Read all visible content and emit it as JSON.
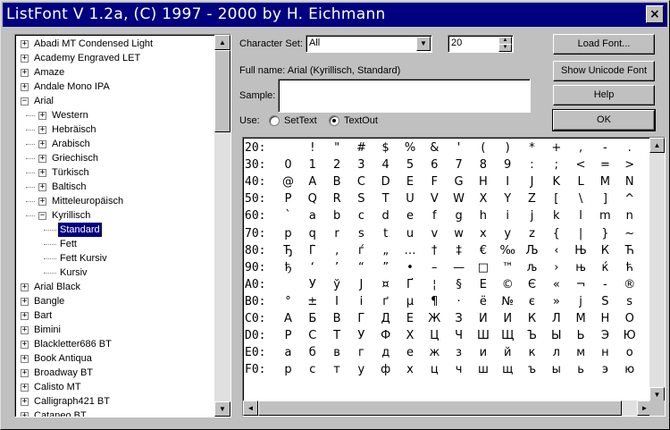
{
  "window": {
    "title": "ListFont V 1.2a, (C) 1997 - 2000 by H. Eichmann",
    "close_label": "×"
  },
  "tree": [
    {
      "label": "Abadi MT Condensed Light",
      "level": 0,
      "expander": "+"
    },
    {
      "label": "Academy Engraved LET",
      "level": 0,
      "expander": "+"
    },
    {
      "label": "Amaze",
      "level": 0,
      "expander": "+"
    },
    {
      "label": "Andale Mono IPA",
      "level": 0,
      "expander": "+"
    },
    {
      "label": "Arial",
      "level": 0,
      "expander": "−"
    },
    {
      "label": "Western",
      "level": 1,
      "expander": "+"
    },
    {
      "label": "Hebräisch",
      "level": 1,
      "expander": "+"
    },
    {
      "label": "Arabisch",
      "level": 1,
      "expander": "+"
    },
    {
      "label": "Griechisch",
      "level": 1,
      "expander": "+"
    },
    {
      "label": "Türkisch",
      "level": 1,
      "expander": "+"
    },
    {
      "label": "Baltisch",
      "level": 1,
      "expander": "+"
    },
    {
      "label": "Mitteleuropäisch",
      "level": 1,
      "expander": "+"
    },
    {
      "label": "Kyrillisch",
      "level": 1,
      "expander": "−"
    },
    {
      "label": "Standard",
      "level": 2,
      "expander": "",
      "selected": true
    },
    {
      "label": "Fett",
      "level": 2,
      "expander": ""
    },
    {
      "label": "Fett Kursiv",
      "level": 2,
      "expander": ""
    },
    {
      "label": "Kursiv",
      "level": 2,
      "expander": ""
    },
    {
      "label": "Arial Black",
      "level": 0,
      "expander": "+"
    },
    {
      "label": "Bangle",
      "level": 0,
      "expander": "+"
    },
    {
      "label": "Bart",
      "level": 0,
      "expander": "+"
    },
    {
      "label": "Bimini",
      "level": 0,
      "expander": "+"
    },
    {
      "label": "Blackletter686 BT",
      "level": 0,
      "expander": "+"
    },
    {
      "label": "Book Antiqua",
      "level": 0,
      "expander": "+"
    },
    {
      "label": "Broadway BT",
      "level": 0,
      "expander": "+"
    },
    {
      "label": "Calisto MT",
      "level": 0,
      "expander": "+"
    },
    {
      "label": "Calligraph421 BT",
      "level": 0,
      "expander": "+"
    },
    {
      "label": "Cataneo BT",
      "level": 0,
      "expander": "+"
    }
  ],
  "controls": {
    "charset_label": "Character Set:",
    "charset_value": "All",
    "size_value": "20",
    "fullname": "Full name: Arial (Kyrillisch, Standard)",
    "sample_label": "Sample:",
    "sample_value": "",
    "use_label": "Use:",
    "radio_settext": "SetText",
    "radio_textout": "TextOut",
    "radio_selected": "TextOut"
  },
  "buttons": {
    "load_font": "Load Font...",
    "show_unicode": "Show Unicode Font",
    "help": "Help",
    "ok": "OK"
  },
  "charmap": [
    {
      "label": "20:",
      "chars": [
        "",
        "!",
        "\"",
        "#",
        "$",
        "%",
        "&",
        "'",
        "(",
        ")",
        "*",
        "+",
        ",",
        "-",
        ".",
        "/"
      ]
    },
    {
      "label": "30:",
      "chars": [
        "0",
        "1",
        "2",
        "3",
        "4",
        "5",
        "6",
        "7",
        "8",
        "9",
        ":",
        ";",
        "<",
        "=",
        ">",
        "?"
      ]
    },
    {
      "label": "40:",
      "chars": [
        "@",
        "A",
        "B",
        "C",
        "D",
        "E",
        "F",
        "G",
        "H",
        "I",
        "J",
        "K",
        "L",
        "M",
        "N",
        "O"
      ]
    },
    {
      "label": "50:",
      "chars": [
        "P",
        "Q",
        "R",
        "S",
        "T",
        "U",
        "V",
        "W",
        "X",
        "Y",
        "Z",
        "[",
        "\\",
        "]",
        "^",
        "_"
      ]
    },
    {
      "label": "60:",
      "chars": [
        "`",
        "a",
        "b",
        "c",
        "d",
        "e",
        "f",
        "g",
        "h",
        "i",
        "j",
        "k",
        "l",
        "m",
        "n",
        "o"
      ]
    },
    {
      "label": "70:",
      "chars": [
        "p",
        "q",
        "r",
        "s",
        "t",
        "u",
        "v",
        "w",
        "x",
        "y",
        "z",
        "{",
        "|",
        "}",
        "~",
        "□"
      ]
    },
    {
      "label": "80:",
      "chars": [
        "Ђ",
        "Ѓ",
        "‚",
        "ѓ",
        "„",
        "…",
        "†",
        "‡",
        "€",
        "‰",
        "Љ",
        "‹",
        "Њ",
        "Ќ",
        "Ћ",
        "Џ"
      ]
    },
    {
      "label": "90:",
      "chars": [
        "ђ",
        "‘",
        "’",
        "“",
        "”",
        "•",
        "–",
        "—",
        "□",
        "™",
        "љ",
        "›",
        "њ",
        "ќ",
        "ћ",
        "џ"
      ]
    },
    {
      "label": "A0:",
      "chars": [
        "",
        "Ў",
        "ў",
        "Ј",
        "¤",
        "Ґ",
        "¦",
        "§",
        "Ё",
        "©",
        "Є",
        "«",
        "¬",
        "-",
        "®",
        "Ї"
      ]
    },
    {
      "label": "B0:",
      "chars": [
        "°",
        "±",
        "І",
        "і",
        "ґ",
        "µ",
        "¶",
        "·",
        "ё",
        "№",
        "є",
        "»",
        "ј",
        "Ѕ",
        "ѕ",
        "ї"
      ]
    },
    {
      "label": "C0:",
      "chars": [
        "А",
        "Б",
        "В",
        "Г",
        "Д",
        "Е",
        "Ж",
        "З",
        "И",
        "Й",
        "К",
        "Л",
        "М",
        "Н",
        "О",
        "П"
      ]
    },
    {
      "label": "D0:",
      "chars": [
        "Р",
        "С",
        "Т",
        "У",
        "Ф",
        "Х",
        "Ц",
        "Ч",
        "Ш",
        "Щ",
        "Ъ",
        "Ы",
        "Ь",
        "Э",
        "Ю",
        "Я"
      ]
    },
    {
      "label": "E0:",
      "chars": [
        "а",
        "б",
        "в",
        "г",
        "д",
        "е",
        "ж",
        "з",
        "и",
        "й",
        "к",
        "л",
        "м",
        "н",
        "о",
        "п"
      ]
    },
    {
      "label": "F0:",
      "chars": [
        "р",
        "с",
        "т",
        "у",
        "ф",
        "х",
        "ц",
        "ч",
        "ш",
        "щ",
        "ъ",
        "ы",
        "ь",
        "э",
        "ю",
        "я"
      ]
    }
  ],
  "icons": {
    "up": "scroll-up-icon",
    "down": "scroll-down-icon",
    "left": "scroll-left-icon",
    "right": "scroll-right-icon"
  }
}
